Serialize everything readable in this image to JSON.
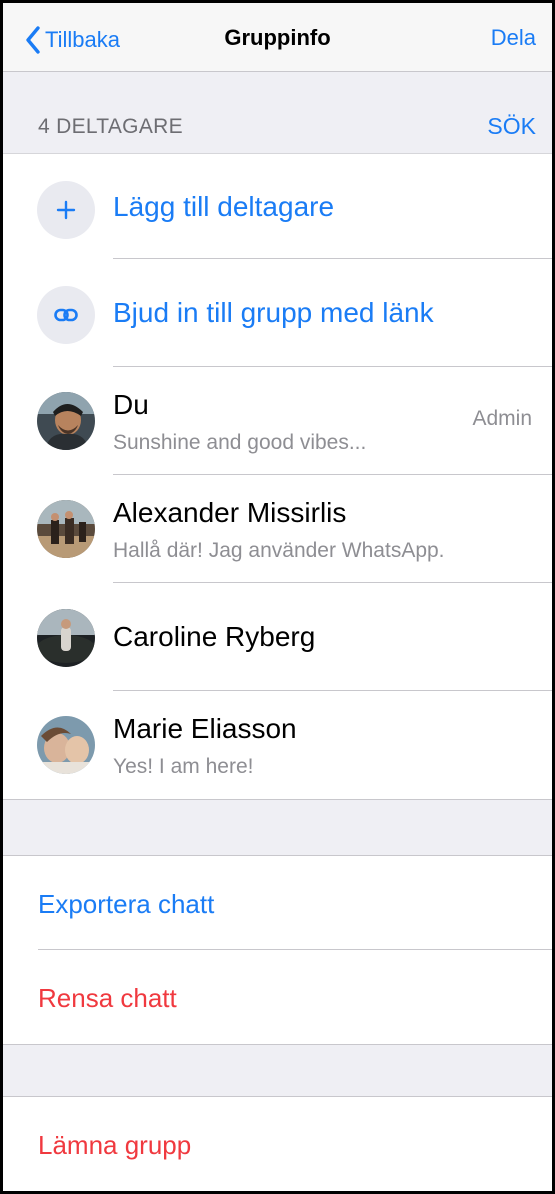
{
  "nav": {
    "back_label": "Tillbaka",
    "title": "Gruppinfo",
    "right_label": "Dela"
  },
  "participants_header": {
    "count_label": "4 DELTAGARE",
    "search_label": "SÖK"
  },
  "actions": {
    "add_label": "Lägg till deltagare",
    "invite_label": "Bjud in till grupp med länk"
  },
  "members": [
    {
      "name": "Du",
      "status": "Sunshine and good vibes...",
      "role": "Admin"
    },
    {
      "name": "Alexander Missirlis",
      "status": "Hallå där! Jag använder WhatsApp."
    },
    {
      "name": "Caroline Ryberg"
    },
    {
      "name": "Marie Eliasson",
      "status": "Yes! I am here!"
    }
  ],
  "chat_actions": {
    "export_label": "Exportera chatt",
    "clear_label": "Rensa chatt"
  },
  "leave": {
    "leave_label": "Lämna grupp"
  },
  "colors": {
    "accent": "#1a7cf5",
    "destructive": "#f0393f",
    "background": "#efeff4"
  },
  "icons": {
    "back": "chevron-left-icon",
    "add": "plus-icon",
    "invite": "link-icon"
  }
}
